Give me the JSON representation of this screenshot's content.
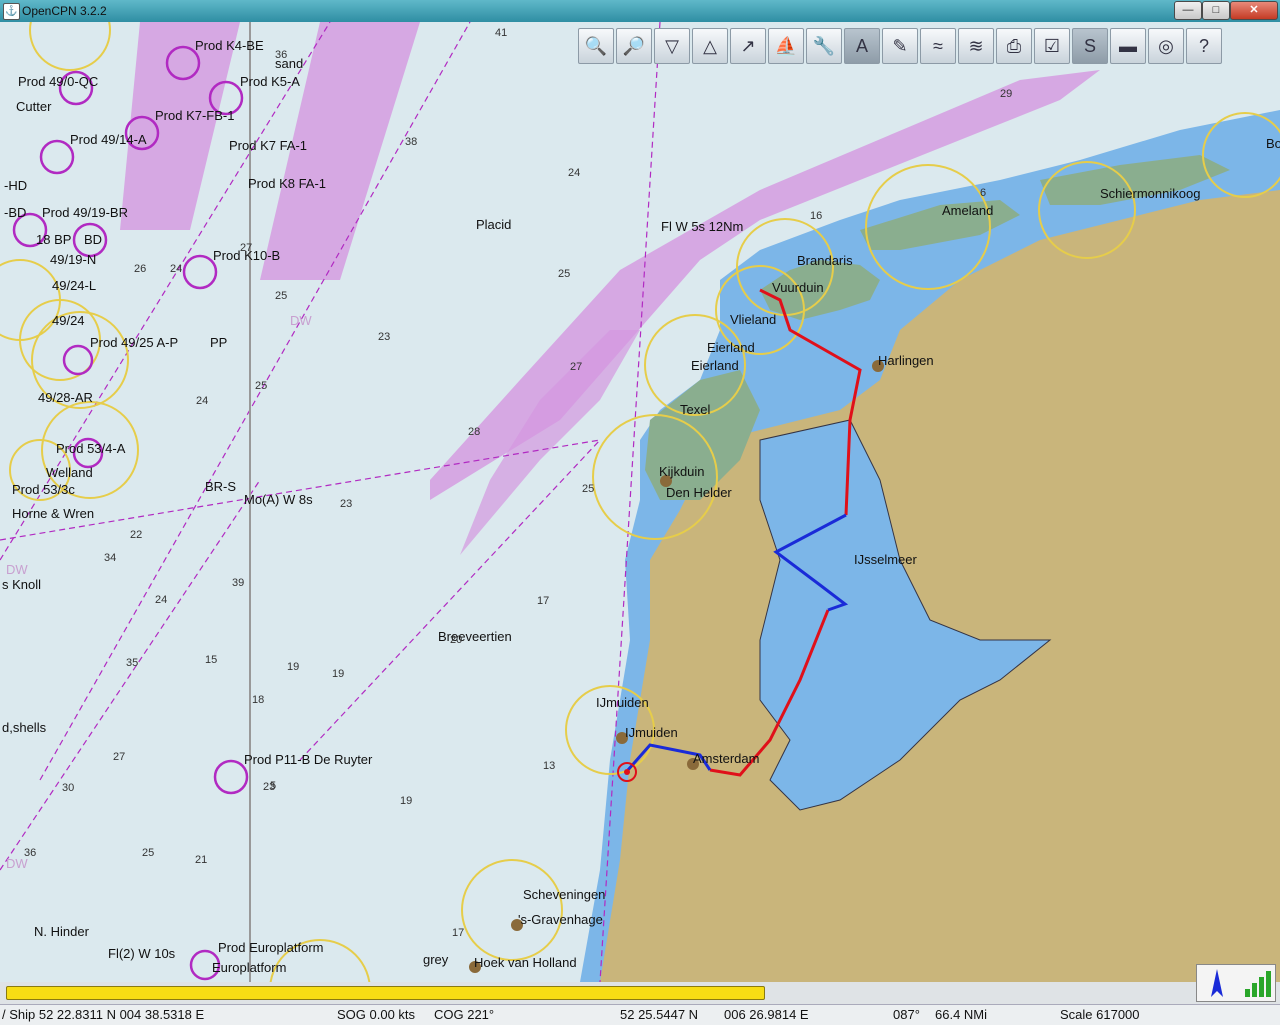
{
  "window": {
    "title": "OpenCPN 3.2.2",
    "minimize": "—",
    "maximize": "□",
    "close": "✕"
  },
  "toolbar": [
    {
      "name": "zoom-in",
      "icon": "🔍"
    },
    {
      "name": "zoom-out",
      "icon": "🔎"
    },
    {
      "name": "scale-down",
      "icon": "▽"
    },
    {
      "name": "scale-up",
      "icon": "△"
    },
    {
      "name": "route",
      "icon": "↗"
    },
    {
      "name": "auto-follow",
      "icon": "⛵"
    },
    {
      "name": "settings",
      "icon": "🔧"
    },
    {
      "name": "text-overlay",
      "icon": "A"
    },
    {
      "name": "current",
      "icon": "✎"
    },
    {
      "name": "tide",
      "icon": "≈"
    },
    {
      "name": "current-overlay",
      "icon": "≋"
    },
    {
      "name": "print",
      "icon": "⎙"
    },
    {
      "name": "route-manager",
      "icon": "☑"
    },
    {
      "name": "track",
      "icon": "S"
    },
    {
      "name": "color-scheme",
      "icon": "▬"
    },
    {
      "name": "mob",
      "icon": "◎"
    },
    {
      "name": "help",
      "icon": "?"
    }
  ],
  "labels": {
    "prod_k4_be": "Prod K4-BE",
    "sand_num": "36",
    "sand": "sand",
    "prod_k5_a": "Prod K5-A",
    "prod_49_qc": "Prod 49/0-QC",
    "cutter": "Cutter",
    "prod_k7": "Prod K7-FB-1",
    "prod_49_14": "Prod 49/14-A",
    "prod_k7_fa": "Prod K7 FA-1",
    "prod_k8": "Prod K8 FA-1",
    "hd": "-HD",
    "bd": "-BD",
    "prod_49_19_br": "Prod 49/19-BR",
    "eighteen_bp": "18 BP",
    "bd2": "BD",
    "n49_19": "49/19-N",
    "n49_24": "49/24-L",
    "prod_k10": "Prod K10-B",
    "prod_49_25": "Prod 49/25 A-P",
    "pp": "PP",
    "n49_24b": "49/24",
    "n49_28": "49/28-AR",
    "prod_53": "Prod 53/4-A",
    "welland": "Welland",
    "prod_53c": "Prod 53/3c",
    "horne": "Horne & Wren",
    "br_s": "BR-S",
    "mo_a": "Mo(A) W 8s",
    "knoll": "s Knoll",
    "shells": "d,shells",
    "placid": "Placid",
    "fl_w": "Fl W 5s 12Nm",
    "brandaris": "Brandaris",
    "vuurduin": "Vuurduin",
    "vlieland": "Vlieland",
    "eierland": "Eierland",
    "eierland2": "Eierland",
    "texel": "Texel",
    "kijkduin": "Kijkduin",
    "den_helder": "Den Helder",
    "harlingen": "Harlingen",
    "ameland": "Ameland",
    "schiermonnikoog": "Schiermonnikoog",
    "bo": "Bo",
    "ijsselmeer": "IJsselmeer",
    "breeveertien": "Breeveertien",
    "ijmuiden1": "IJmuiden",
    "ijmuiden2": "IJmuiden",
    "amsterdam": "Amsterdam",
    "prod_p11": "Prod P11-B De Ruyter",
    "scheveningen": "Scheveningen",
    "gravenhage": "'s-Gravenhage",
    "hoek": "Hoek van Holland",
    "grey": "grey",
    "n_hinder": "N. Hinder",
    "fl2": "Fl(2) W 10s",
    "prod_euro": "Prod Europlatform",
    "euro2": "Europlatform",
    "dw1": "DW",
    "dw2": "DW",
    "dw3": "DW"
  },
  "depths": [
    "41",
    "38",
    "24",
    "16",
    "6",
    "29",
    "27",
    "26",
    "25",
    "24",
    "23",
    "25",
    "27",
    "28",
    "25",
    "22",
    "34",
    "39",
    "24",
    "35",
    "15",
    "19",
    "19",
    "18",
    "20",
    "17",
    "13",
    "23",
    "19",
    "27",
    "30",
    "25",
    "21",
    "17",
    "36",
    "23",
    "24",
    "5",
    "25"
  ],
  "status": {
    "ship": "/ Ship 52 22.8311 N   004 38.5318 E",
    "sog": "SOG 0.00 kts",
    "cog": "COG 221°",
    "cursor_lat": "52 25.5447 N",
    "cursor_lon": "006 26.9814 E",
    "bearing": "087°",
    "distance": "66.4 NMi",
    "scale": "Scale 617000"
  },
  "colors": {
    "sea": "#dbe9ee",
    "shallow": "#7cb6e8",
    "land": "#c9b57b",
    "wetland": "#8aae8f",
    "tss": "#d497e0",
    "route_red": "#e0101a",
    "route_blue": "#1a2bd8",
    "ring": "#e6cd4a",
    "magenta": "#b12ac2"
  }
}
